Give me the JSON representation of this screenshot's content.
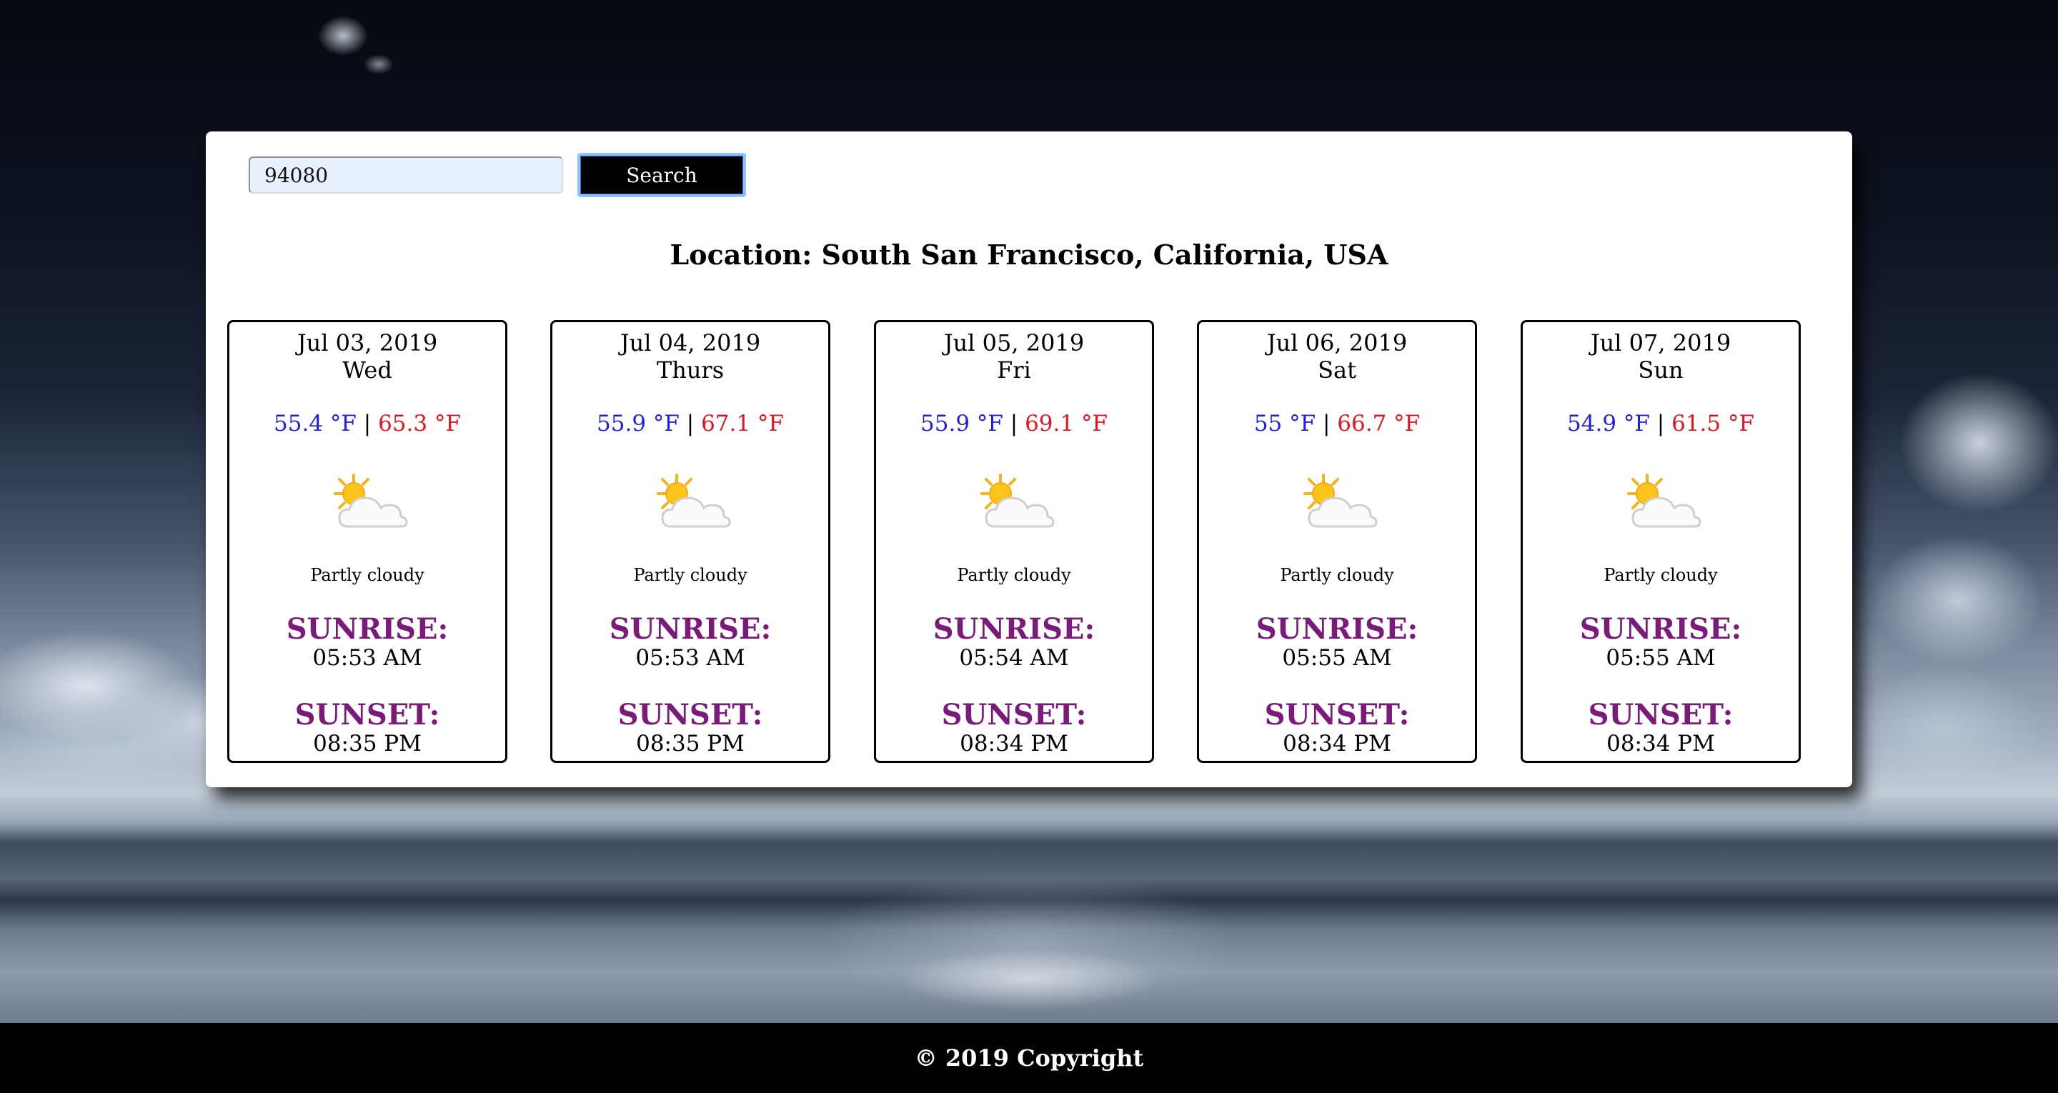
{
  "search": {
    "value": "94080",
    "button_label": "Search"
  },
  "location": "Location: South San Francisco, California, USA",
  "forecast": [
    {
      "date": "Jul 03, 2019",
      "day": "Wed",
      "low": "55.4 °F",
      "separator": "|",
      "high": "65.3 °F",
      "condition": "Partly cloudy",
      "icon": "partly-cloudy-icon",
      "sunrise_label": "SUNRISE:",
      "sunrise": "05:53 AM",
      "sunset_label": "SUNSET:",
      "sunset": "08:35 PM"
    },
    {
      "date": "Jul 04, 2019",
      "day": "Thurs",
      "low": "55.9 °F",
      "separator": "|",
      "high": "67.1 °F",
      "condition": "Partly cloudy",
      "icon": "partly-cloudy-icon",
      "sunrise_label": "SUNRISE:",
      "sunrise": "05:53 AM",
      "sunset_label": "SUNSET:",
      "sunset": "08:35 PM"
    },
    {
      "date": "Jul 05, 2019",
      "day": "Fri",
      "low": "55.9 °F",
      "separator": "|",
      "high": "69.1 °F",
      "condition": "Partly cloudy",
      "icon": "partly-cloudy-icon",
      "sunrise_label": "SUNRISE:",
      "sunrise": "05:54 AM",
      "sunset_label": "SUNSET:",
      "sunset": "08:34 PM"
    },
    {
      "date": "Jul 06, 2019",
      "day": "Sat",
      "low": "55 °F",
      "separator": "|",
      "high": "66.7 °F",
      "condition": "Partly cloudy",
      "icon": "partly-cloudy-icon",
      "sunrise_label": "SUNRISE:",
      "sunrise": "05:55 AM",
      "sunset_label": "SUNSET:",
      "sunset": "08:34 PM"
    },
    {
      "date": "Jul 07, 2019",
      "day": "Sun",
      "low": "54.9 °F",
      "separator": "|",
      "high": "61.5 °F",
      "condition": "Partly cloudy",
      "icon": "partly-cloudy-icon",
      "sunrise_label": "SUNRISE:",
      "sunrise": "05:55 AM",
      "sunset_label": "SUNSET:",
      "sunset": "08:34 PM"
    }
  ],
  "footer": {
    "copyright": "© 2019 Copyright"
  },
  "colors": {
    "low_temp": "#1f1fe6",
    "high_temp": "#e6141e",
    "sun_label": "#7b1a7b",
    "button_bg": "#000000",
    "input_bg": "#e8f0fe"
  }
}
